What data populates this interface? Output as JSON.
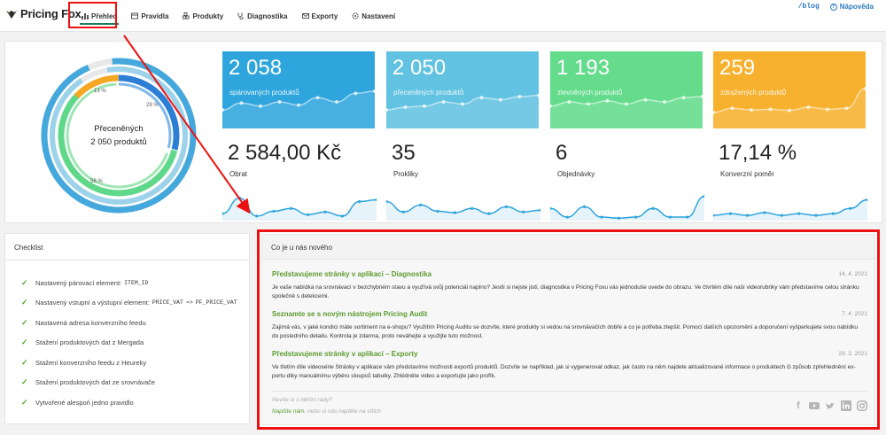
{
  "app": {
    "brand": "Pricing Fox"
  },
  "nav": {
    "items": [
      {
        "label": "Přehled",
        "icon": "chart-bars-icon",
        "active": true
      },
      {
        "label": "Pravidla",
        "icon": "table-icon"
      },
      {
        "label": "Produkty",
        "icon": "cubes-icon"
      },
      {
        "label": "Diagnostika",
        "icon": "stethoscope-icon"
      },
      {
        "label": "Exporty",
        "icon": "envelope-icon"
      },
      {
        "label": "Nastavení",
        "icon": "gear-icon"
      }
    ],
    "blog": "/blog",
    "help": "Nápověda"
  },
  "donut": {
    "title": "Přeceněných",
    "value": "2 050 produktů",
    "segments": [
      {
        "label": "13 %",
        "color": "#f5a623"
      },
      {
        "label": "29 %",
        "color": "#2d7fd6"
      },
      {
        "label": "58 %",
        "color": "#5fd88a"
      }
    ],
    "outer_colors": [
      "#45a8dc",
      "#9cd3ea",
      "#e8e8e8"
    ]
  },
  "kpis": [
    {
      "value": "2 058",
      "label": "spárovaných produktů",
      "color": "#2ea5dc",
      "line": [
        0.35,
        0.48,
        0.42,
        0.5,
        0.44,
        0.58,
        0.5,
        0.66,
        0.7
      ]
    },
    {
      "value": "2 050",
      "label": "přeceněných produktů",
      "color": "#62c2e2",
      "line": [
        0.35,
        0.4,
        0.42,
        0.5,
        0.46,
        0.58,
        0.54,
        0.6,
        0.62
      ]
    },
    {
      "value": "1 193",
      "label": "zlevněných produktů",
      "color": "#64dc8c",
      "line": [
        0.42,
        0.5,
        0.46,
        0.52,
        0.46,
        0.54,
        0.5,
        0.58,
        0.6
      ]
    },
    {
      "value": "259",
      "label": "zdražených produktů",
      "color": "#f7b12e",
      "line": [
        0.3,
        0.38,
        0.35,
        0.36,
        0.34,
        0.4,
        0.36,
        0.38,
        0.75
      ]
    }
  ],
  "stats": [
    {
      "value": "2 584,00 Kč",
      "label": "Obrat",
      "line": [
        0.15,
        0.6,
        0.08,
        0.22,
        0.3,
        0.12,
        0.2,
        0.08,
        0.5,
        0.55
      ]
    },
    {
      "value": "35",
      "label": "Prokliky",
      "line": [
        0.5,
        0.2,
        0.4,
        0.22,
        0.18,
        0.3,
        0.15,
        0.35,
        0.2,
        0.25
      ]
    },
    {
      "value": "6",
      "label": "Objednávky",
      "line": [
        0.3,
        0.05,
        0.35,
        0.05,
        0.02,
        0.05,
        0.3,
        0.05,
        0.05,
        0.65
      ]
    },
    {
      "value": "17,14 %",
      "label": "Konverzní poměr",
      "line": [
        0.1,
        0.15,
        0.1,
        0.18,
        0.1,
        0.15,
        0.1,
        0.15,
        0.3,
        0.55
      ]
    }
  ],
  "checklist": {
    "title": "Checklist",
    "items": [
      {
        "text": "Nastavený párovací element:",
        "code": "ITEM_ID"
      },
      {
        "text": "Nastavený vstupní a výstupní element:",
        "code": "PRICE_VAT",
        "arrow": "=>",
        "code2": "PF_PRICE_VAT"
      },
      {
        "text": "Nastavená adresa konverzního feedu"
      },
      {
        "text": "Stažení produktových dat z Mergada"
      },
      {
        "text": "Stažení konverzního feedu z Heureky"
      },
      {
        "text": "Stažení produktových dat ze srovnávače"
      },
      {
        "text": "Vytvořené alespoň jedno pravidlo"
      }
    ]
  },
  "news": {
    "title": "Co je u nás nového",
    "items": [
      {
        "title": "Představujeme stránky v aplikaci – Diagnostika",
        "date": "14. 4. 2021",
        "text": "Je vaše nabídka na srovnávací v bezchybném stavu a využívá svůj potenciál naplno? Jestli si nejste jisti, diagnostika v Pricing Foxu vás jednoduše uvede do obrazu. Ve čtvrtém díle naší videorubriky vám představíme celou stránku společně s detekcemi."
      },
      {
        "title": "Seznamte se s novým nástrojem Pricing Audit",
        "date": "7. 4. 2021",
        "text": "Zajímá vás, v jaké kondici máte sortiment na e-shopu? Využitím Pricing Auditu se dozvíte, které produkty si vedou na srovnávačích dobře a co je potřeba zlepšit. Pomocí dalších upozornění a doporučení vyšperkujete svou nabídku do posledního detailu. Kontrola je zdarma, proto neváhejte a využijte tuto možnost."
      },
      {
        "title": "Představujeme stránky v aplikaci – Exporty",
        "date": "29. 3. 2021",
        "text": "Ve třetím díle videosérie Stránky v aplikace vám představíme možnosti exportů produktů. Dozvíte se například, jak si vygenerovat odkaz, jak často na něm najdete aktualizované informace o produktech či způsob zpřehlednění ex-portu díky manuálnímu výběru sloupců tabulky. Zhlédněte video a exportujte jako profík."
      }
    ],
    "footer_question": "Nevíte si s něčím rady?",
    "footer_link": "Napište nám",
    "footer_rest": ", nebo si nás najděte na sítích",
    "socials": [
      "facebook-icon",
      "youtube-icon",
      "twitter-icon",
      "linkedin-icon",
      "instagram-icon"
    ]
  }
}
